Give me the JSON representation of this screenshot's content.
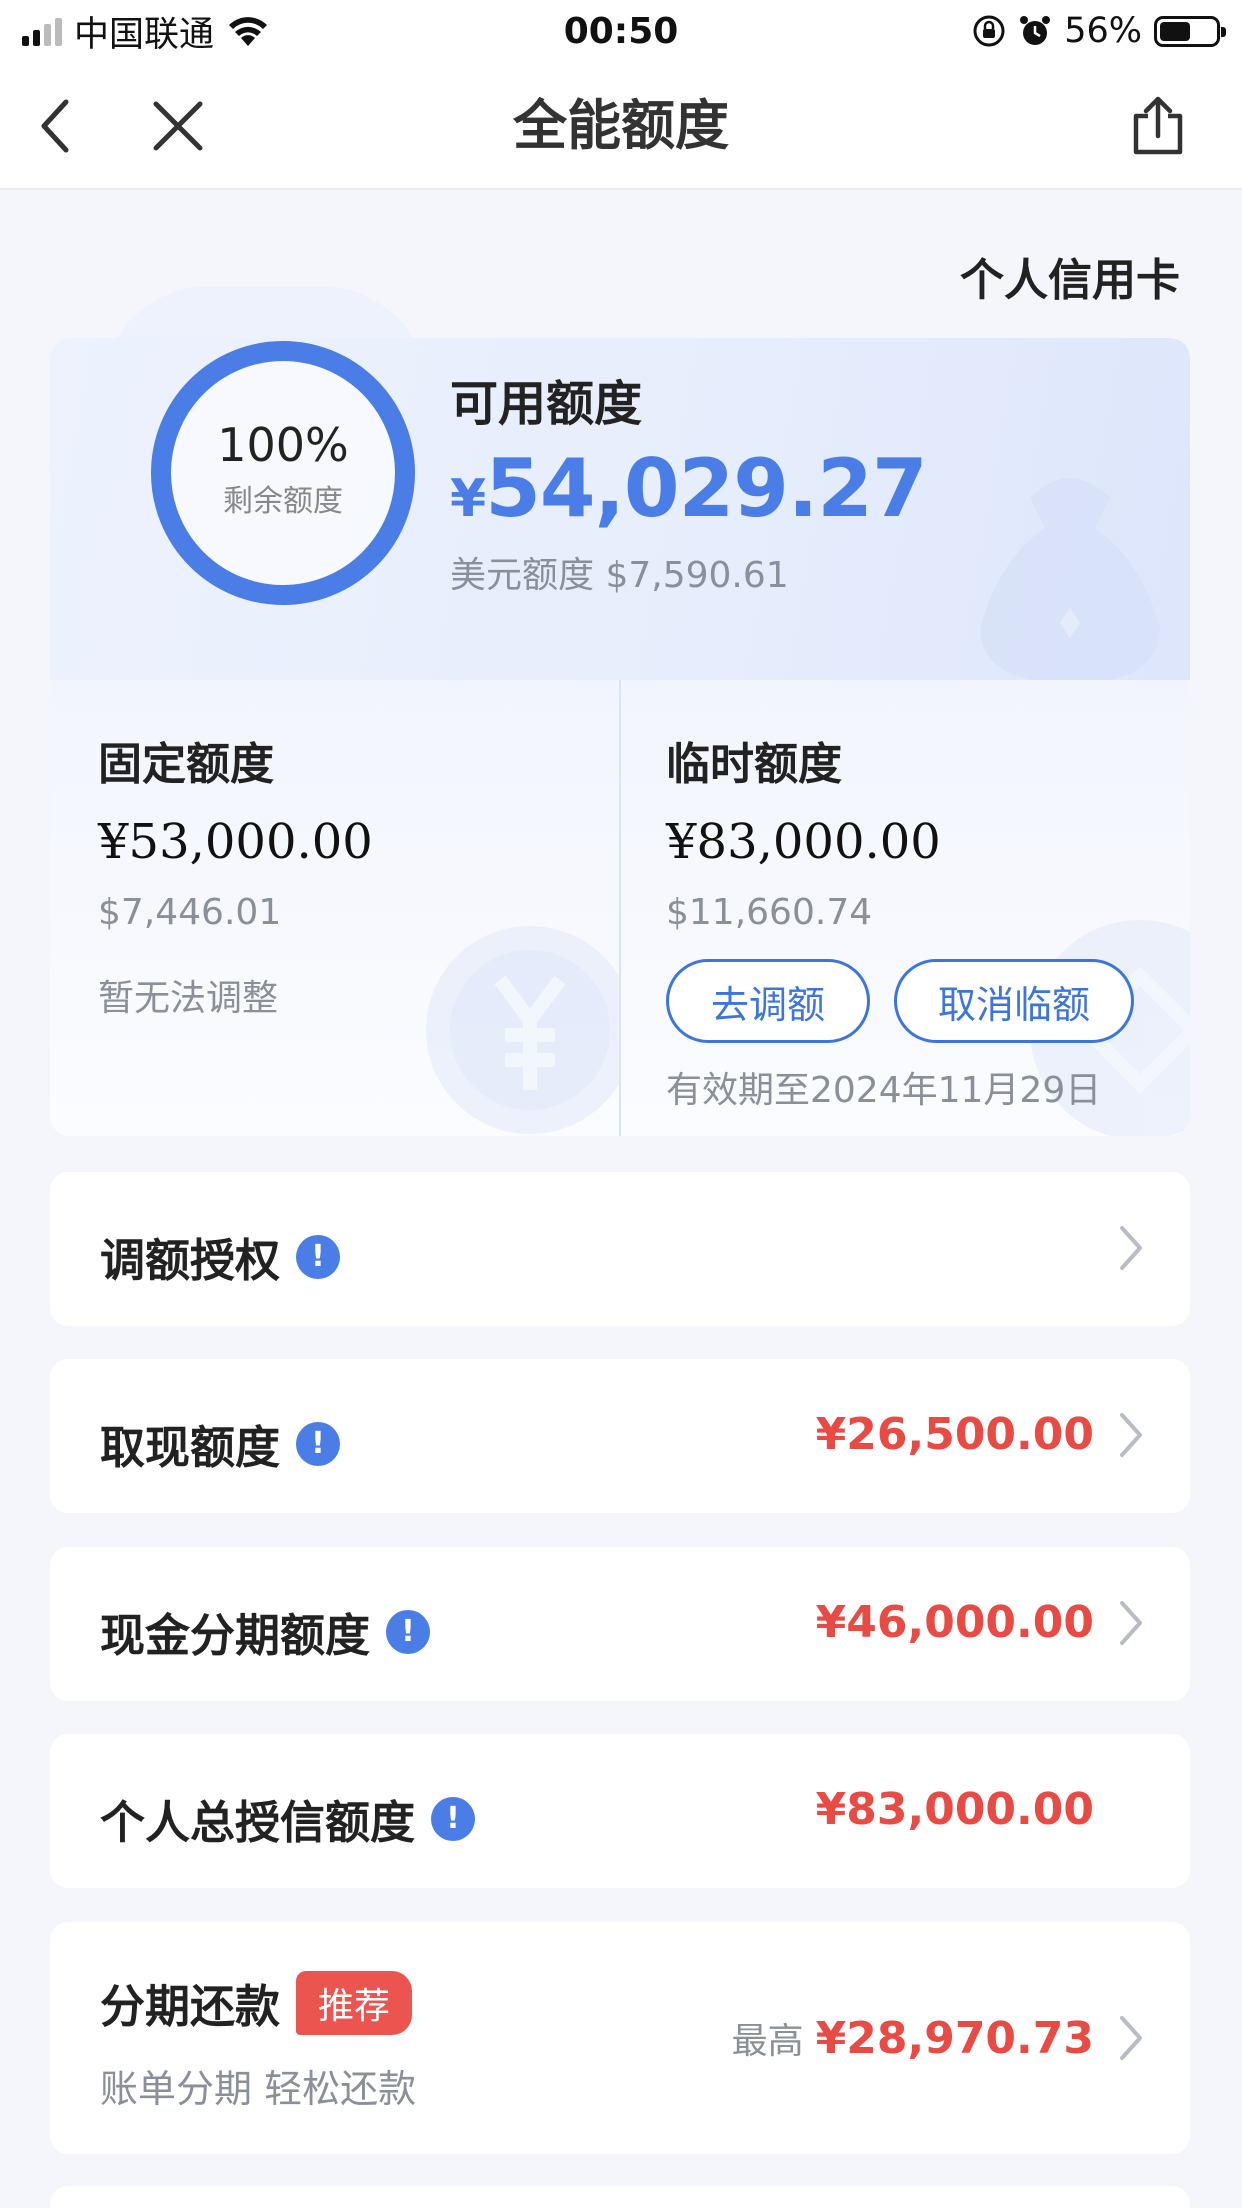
{
  "status_bar": {
    "carrier": "中国联通",
    "time": "00:50",
    "battery_pct_label": "56%",
    "battery_level": 0.56
  },
  "nav": {
    "title": "全能额度",
    "back_icon": "chevron-left-icon",
    "close_icon": "close-icon",
    "share_icon": "share-icon"
  },
  "account_type": "个人信用卡",
  "summary": {
    "remaining_pct": "100%",
    "remaining_label": "剩余额度",
    "remaining_fraction": 1.0,
    "available_title": "可用额度",
    "available_currency": "¥",
    "available_amount": "54,029.27",
    "usd_line": "美元额度 $7,590.61"
  },
  "fixed_limit": {
    "title": "固定额度",
    "amount": "¥53,000.00",
    "usd": "$7,446.01",
    "note": "暂无法调整"
  },
  "temp_limit": {
    "title": "临时额度",
    "amount": "¥83,000.00",
    "usd": "$11,660.74",
    "adjust_button": "去调额",
    "cancel_button": "取消临额",
    "valid_until": "有效期至2024年11月29日"
  },
  "rows": [
    {
      "label": "调额授权",
      "value": ""
    },
    {
      "label": "取现额度",
      "value": "¥26,500.00"
    },
    {
      "label": "现金分期额度",
      "value": "¥46,000.00"
    },
    {
      "label": "个人总授信额度",
      "value": "¥83,000.00"
    }
  ],
  "installment": {
    "label": "分期还款",
    "badge": "推荐",
    "subtitle": "账单分期 轻松还款",
    "max_prefix": "最高",
    "value": "¥28,970.73"
  },
  "colors": {
    "accent_blue": "#4a7ee6",
    "amount_red": "#e84a44",
    "badge_red": "#ec544f"
  }
}
